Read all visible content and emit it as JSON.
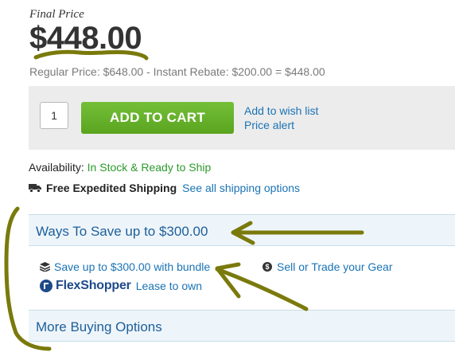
{
  "product": {
    "final_label": "Final Price",
    "price": "$448.00",
    "price_detail": "Regular Price: $648.00 - Instant Rebate: $200.00 = $448.00"
  },
  "cart": {
    "quantity": "1",
    "add_to_cart_label": "ADD TO CART",
    "wish_list_label": "Add to wish list",
    "price_alert_label": "Price alert"
  },
  "availability": {
    "label": "Availability:",
    "status": "In Stock & Ready to Ship",
    "status_color": "#2c9a2c"
  },
  "shipping": {
    "icon": "truck-icon",
    "title": "Free Expedited Shipping",
    "options_link": "See all shipping options"
  },
  "ways_to_save": {
    "title": "Ways To Save up to $300.00",
    "bundle_icon": "layers-icon",
    "bundle_link": "Save up to $300.00 with bundle",
    "sell_icon": "dollar-circle-icon",
    "sell_link": "Sell or Trade your Gear",
    "flexshopper": {
      "logo_part1": "Flex",
      "logo_part2": "Shopper",
      "lease_link": "Lease to own"
    }
  },
  "more_buying": {
    "title": "More Buying Options"
  },
  "colors": {
    "accent_link": "#1a73b5",
    "cart_button": "#5aa41f",
    "annotation": "#7a7a0c"
  }
}
